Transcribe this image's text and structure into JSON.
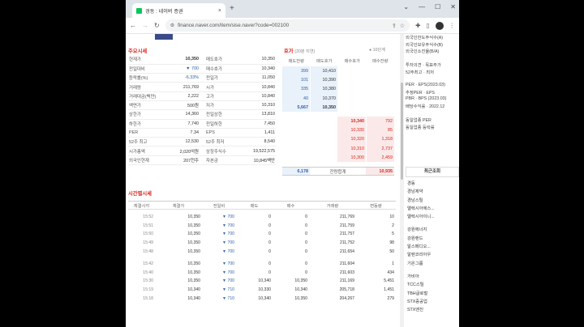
{
  "browser": {
    "tab_title": "경동 : 네이버 증권",
    "tab_close": "×",
    "new_tab": "+",
    "url": "finance.naver.com/item/sise.naver?code=002100",
    "window_controls": [
      "⌄",
      "—",
      "☐",
      "✕"
    ]
  },
  "price_section": {
    "title": "주요시세",
    "rows": [
      {
        "l1": "현재가",
        "v1": "10,350",
        "l2": "매도호가",
        "v2": "10,350"
      },
      {
        "l1": "전일대비",
        "v1": "▼ 700",
        "l2": "매수호가",
        "v2": "10,340"
      },
      {
        "l1": "등락률(%)",
        "v1": "-6.33%",
        "l2": "전일가",
        "v2": "11,050"
      },
      {
        "l1": "거래량",
        "v1": "211,769",
        "l2": "시가",
        "v2": "10,840"
      },
      {
        "l1": "거래대금(백만)",
        "v1": "2,222",
        "l2": "고가",
        "v2": "10,840"
      },
      {
        "l1": "액면가",
        "v1": "500원",
        "l2": "저가",
        "v2": "10,310"
      },
      {
        "l1": "상한가",
        "v1": "14,360",
        "l2": "전일상한",
        "v2": "13,810"
      },
      {
        "l1": "하한가",
        "v1": "7,740",
        "l2": "전일하한",
        "v2": "7,450"
      },
      {
        "l1": "PER",
        "v1": "7.34",
        "l2": "EPS",
        "v2": "1,411"
      },
      {
        "l1": "52주 최고",
        "v1": "12,530",
        "l2": "52주 최저",
        "v2": "8,540"
      },
      {
        "l1": "시가총액",
        "v1": "2,020억원",
        "l2": "상장주식수",
        "v2": "19,522,575"
      },
      {
        "l1": "외국인현재",
        "v1": "207천주",
        "l2": "자본금",
        "v2": "10,845백만"
      }
    ]
  },
  "hoga": {
    "title": "호가",
    "subtitle": "(20분 지연)",
    "levels_label": "10단계",
    "headers": [
      "매도잔량",
      "매도호가",
      "매수호가",
      "매수잔량"
    ],
    "sell": [
      {
        "qty": "399",
        "price": "10,410"
      },
      {
        "qty": "101",
        "price": "10,390"
      },
      {
        "qty": "335",
        "price": "10,380"
      },
      {
        "qty": "40",
        "price": "10,370"
      },
      {
        "qty": "5,667",
        "price": "10,350"
      }
    ],
    "buy": [
      {
        "price": "10,340",
        "qty": "792"
      },
      {
        "price": "10,330",
        "qty": "85"
      },
      {
        "price": "10,320",
        "qty": "1,318"
      },
      {
        "price": "10,310",
        "qty": "2,737"
      },
      {
        "price": "10,300",
        "qty": "2,459"
      }
    ],
    "total_sell": "6,178",
    "total_label": "잔량합계",
    "total_buy": "10,935"
  },
  "ticks": {
    "title": "시간별시세",
    "headers": [
      "체결시각",
      "체결가",
      "전일비",
      "매도",
      "매수",
      "거래량",
      "변동량"
    ],
    "group1": [
      {
        "time": "15:52",
        "price": "10,350",
        "diff": "▼ 700",
        "sell": "0",
        "buy": "0",
        "vol": "211,769",
        "chg": "10"
      },
      {
        "time": "15:51",
        "price": "10,350",
        "diff": "▼ 700",
        "sell": "0",
        "buy": "0",
        "vol": "211,759",
        "chg": "2"
      },
      {
        "time": "15:50",
        "price": "10,350",
        "diff": "▼ 700",
        "sell": "0",
        "buy": "0",
        "vol": "211,757",
        "chg": "5"
      },
      {
        "time": "15:49",
        "price": "10,350",
        "diff": "▼ 700",
        "sell": "0",
        "buy": "0",
        "vol": "211,752",
        "chg": "98"
      },
      {
        "time": "15:48",
        "price": "10,350",
        "diff": "▼ 700",
        "sell": "0",
        "buy": "0",
        "vol": "211,654",
        "chg": "50"
      }
    ],
    "group2": [
      {
        "time": "15:42",
        "price": "10,350",
        "diff": "▼ 700",
        "sell": "0",
        "buy": "0",
        "vol": "211,604",
        "chg": "1"
      },
      {
        "time": "15:40",
        "price": "10,350",
        "diff": "▼ 700",
        "sell": "0",
        "buy": "0",
        "vol": "211,603",
        "chg": "434"
      },
      {
        "time": "15:30",
        "price": "10,350",
        "diff": "▼ 700",
        "sell": "10,340",
        "buy": "10,350",
        "vol": "211,169",
        "chg": "5,451"
      },
      {
        "time": "15:19",
        "price": "10,340",
        "diff": "▼ 710",
        "sell": "10,330",
        "buy": "10,340",
        "vol": "205,718",
        "chg": "1,451"
      },
      {
        "time": "15:18",
        "price": "10,340",
        "diff": "▼ 710",
        "sell": "10,340",
        "buy": "10,350",
        "vol": "204,267",
        "chg": "279"
      }
    ]
  },
  "sidebar": {
    "info_lines": [
      "외국인한도주식수(A)",
      "외국인보유주식수(B)",
      "외국인소진율(B/A)",
      "",
      "투자의견 · 목표주가",
      "52주최고 · 최저",
      "",
      "PER · EPS(2023.03)",
      "추정PER · EPS",
      "PBR · BPS (2023.03)",
      "배당수익률 · 2022.12",
      "",
      "동일업종 PER",
      "동일업종 등락률"
    ],
    "recent_title": "최근조회",
    "recent_group1": [
      "경동",
      "경남제약",
      "경남스틸",
      "엘렉시아에스...",
      "엘렉시아이니..."
    ],
    "recent_group2": [
      "강원에너지",
      "강원랜드",
      "알스메디오...",
      "알렌코리아우",
      "기온그룹"
    ],
    "recent_group3": [
      "가비아",
      "TCC스틸",
      "TBH글로벌",
      "STX중공업",
      "STX엔진"
    ]
  }
}
